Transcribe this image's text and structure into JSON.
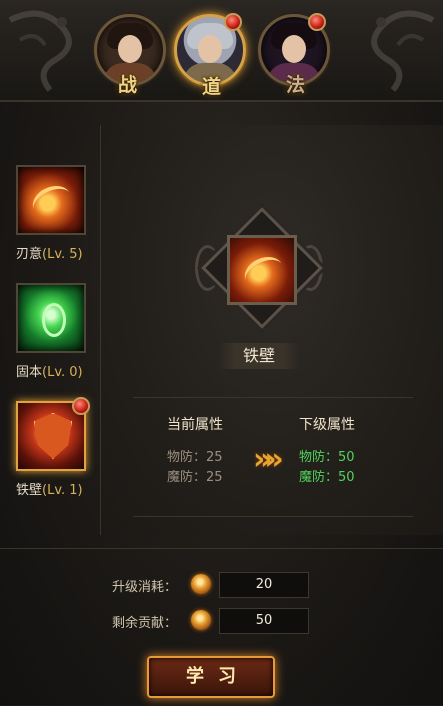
{
  "portraits": [
    {
      "tag": "战",
      "active": false,
      "badge": false
    },
    {
      "tag": "道",
      "active": true,
      "badge": true
    },
    {
      "tag": "法",
      "active": false,
      "badge": true
    }
  ],
  "skills": [
    {
      "name": "刃意",
      "level": "(Lv. 5)",
      "icon": "slash-skill-icon"
    },
    {
      "name": "固本",
      "level": "(Lv. 0)",
      "icon": "green-aura-skill-icon"
    },
    {
      "name": "铁壁",
      "level": "(Lv. 1)",
      "icon": "shield-skill-icon",
      "selected": true,
      "badge": true
    }
  ],
  "detail": {
    "title": "铁壁",
    "current": {
      "heading": "当前属性",
      "rows": [
        "物防：25",
        "魔防：25"
      ]
    },
    "next": {
      "heading": "下级属性",
      "rows": [
        "物防：50",
        "魔防：50"
      ]
    }
  },
  "cost": {
    "upgrade_label": "升级消耗：",
    "upgrade_value": "20",
    "remaining_label": "剩余贡献：",
    "remaining_value": "50"
  },
  "learn_button": "学习",
  "colors": {
    "accent": "#e7a531",
    "upgrade_green": "#4fd35a",
    "badge_red": "#c11a12"
  }
}
